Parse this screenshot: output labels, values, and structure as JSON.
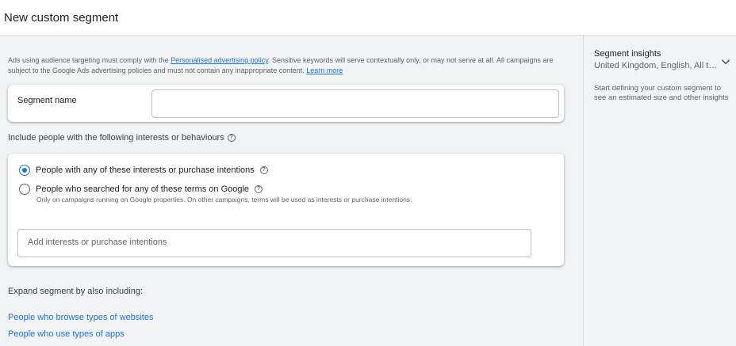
{
  "header": {
    "title": "New custom segment"
  },
  "policy": {
    "text_before": "Ads using audience targeting must comply with the ",
    "policy_link": "Personalised advertising policy",
    "text_after": ". Sensitive keywords will serve contextually only, or may not serve at all. All campaigns are subject to the Google Ads advertising policies and must not contain any inappropriate content. ",
    "learn_more": "Learn more"
  },
  "segment_name": {
    "label": "Segment name",
    "value": ""
  },
  "include": {
    "title": "Include people with the following interests or behaviours",
    "help_icon": "help-circle-icon",
    "options": [
      {
        "label": "People with any of these interests or purchase intentions",
        "selected": true
      },
      {
        "label": "People who searched for any of these terms on Google",
        "selected": false,
        "sub": "Only on campaigns running on Google properties. On other campaigns, terms will be used as interests or purchase intentions."
      }
    ],
    "input_placeholder": "Add interests or purchase intentions"
  },
  "expand": {
    "title": "Expand segment by also including:",
    "links": [
      "People who browse types of websites",
      "People who use types of apps"
    ]
  },
  "insights": {
    "title": "Segment insights",
    "subtitle": "United Kingdom, English, All types of ads",
    "hint": "Start defining your custom segment to see an estimated size and other insights",
    "chevron_icon": "chevron-down-icon"
  },
  "colors": {
    "accent": "#1a73e8",
    "background": "#f1f3f4"
  }
}
